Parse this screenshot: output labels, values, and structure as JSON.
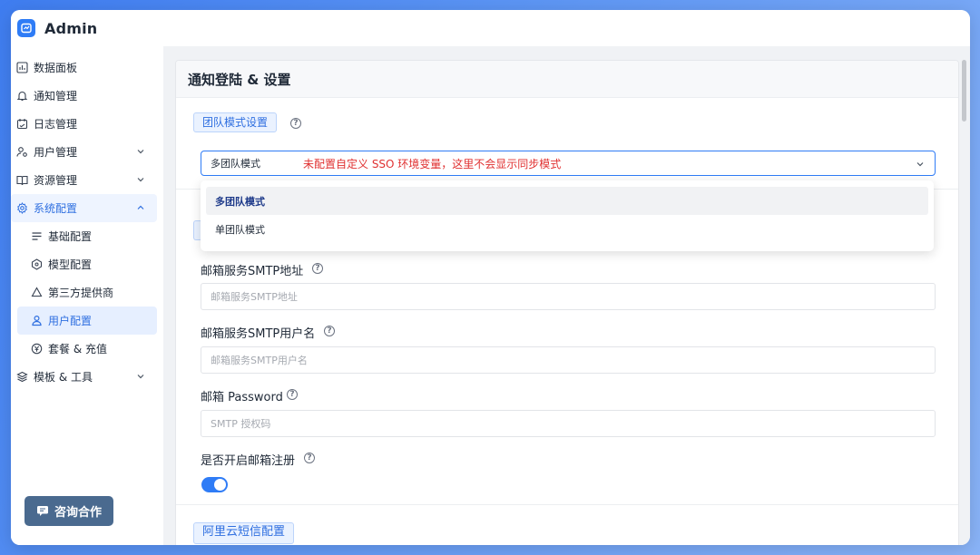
{
  "app": {
    "title": "Admin"
  },
  "sidebar": {
    "items": [
      {
        "label": "数据面板",
        "icon": "chart-icon"
      },
      {
        "label": "通知管理",
        "icon": "bell-icon"
      },
      {
        "label": "日志管理",
        "icon": "calendar-icon"
      },
      {
        "label": "用户管理",
        "icon": "user-group-icon",
        "expandable": true
      },
      {
        "label": "资源管理",
        "icon": "book-icon",
        "expandable": true
      },
      {
        "label": "系统配置",
        "icon": "gear-icon",
        "expanded": true
      }
    ],
    "sub_items": [
      {
        "label": "基础配置",
        "icon": "menu-lines-icon"
      },
      {
        "label": "模型配置",
        "icon": "model-icon"
      },
      {
        "label": "第三方提供商",
        "icon": "triangle-nodes-icon"
      },
      {
        "label": "用户配置",
        "icon": "user-icon",
        "selected": true
      },
      {
        "label": "套餐 & 充值",
        "icon": "yen-icon"
      }
    ],
    "tail_items": [
      {
        "label": "模板 & 工具",
        "icon": "layers-icon",
        "expandable": true
      }
    ],
    "consult_label": "咨询合作"
  },
  "main": {
    "card_title": "通知登陆 & 设置",
    "team_section": "团队模式设置",
    "select_value": "多团队模式",
    "select_warning": "未配置自定义 SSO 环境变量，这里不会显示同步模式",
    "options": [
      "多团队模式",
      "单团队模式"
    ],
    "fields": [
      {
        "label": "邮箱服务SMTP地址",
        "placeholder": "邮箱服务SMTP地址"
      },
      {
        "label": "邮箱服务SMTP用户名",
        "placeholder": "邮箱服务SMTP用户名"
      },
      {
        "label": "邮箱 Password",
        "placeholder": "SMTP 授权码"
      }
    ],
    "email_register_label": "是否开启邮箱注册",
    "email_register_enabled": true,
    "sms_section": "阿里云短信配置",
    "help_glyph": "?"
  },
  "colors": {
    "accent": "#2f7cf6",
    "warning": "#e03131",
    "selected_bg": "#e6efff"
  }
}
